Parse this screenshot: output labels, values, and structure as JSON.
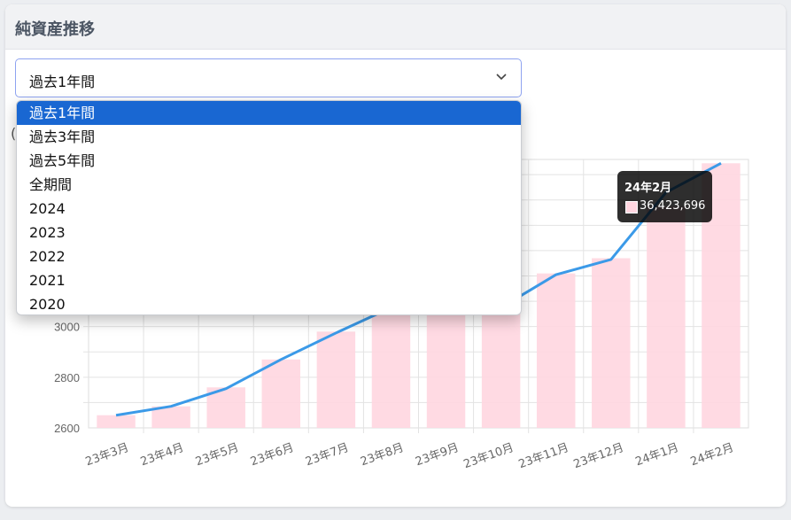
{
  "card": {
    "title": "純資産推移"
  },
  "period_select": {
    "value": "過去1年間",
    "options": [
      "過去1年間",
      "過去3年間",
      "過去5年間",
      "全期間",
      "2024",
      "2023",
      "2022",
      "2021",
      "2020"
    ],
    "selected_index": 0
  },
  "clipped_text": "(",
  "tooltip": {
    "title": "24年2月",
    "value": "36,423,696"
  },
  "colors": {
    "line": "#3b9ae8",
    "bar": "#ffd6e0",
    "selected": "#1967d2"
  },
  "chart_data": {
    "type": "bar+line",
    "categories": [
      "23年3月",
      "23年4月",
      "23年5月",
      "23年6月",
      "23年7月",
      "23年8月",
      "23年9月",
      "23年10月",
      "23年11月",
      "23年12月",
      "24年1月",
      "24年2月"
    ],
    "series": [
      {
        "type": "bar",
        "values": [
          2650,
          2685,
          2760,
          2870,
          2980,
          3075,
          3100,
          3075,
          3210,
          3270,
          3475,
          3645
        ]
      },
      {
        "type": "line",
        "values": [
          2650,
          2685,
          2755,
          2870,
          2975,
          3075,
          3100,
          3075,
          3205,
          3265,
          3530,
          3645
        ]
      }
    ],
    "y_ticks": [
      2600,
      2800,
      3000
    ],
    "ylim": [
      2600,
      3660
    ],
    "grid": true
  }
}
